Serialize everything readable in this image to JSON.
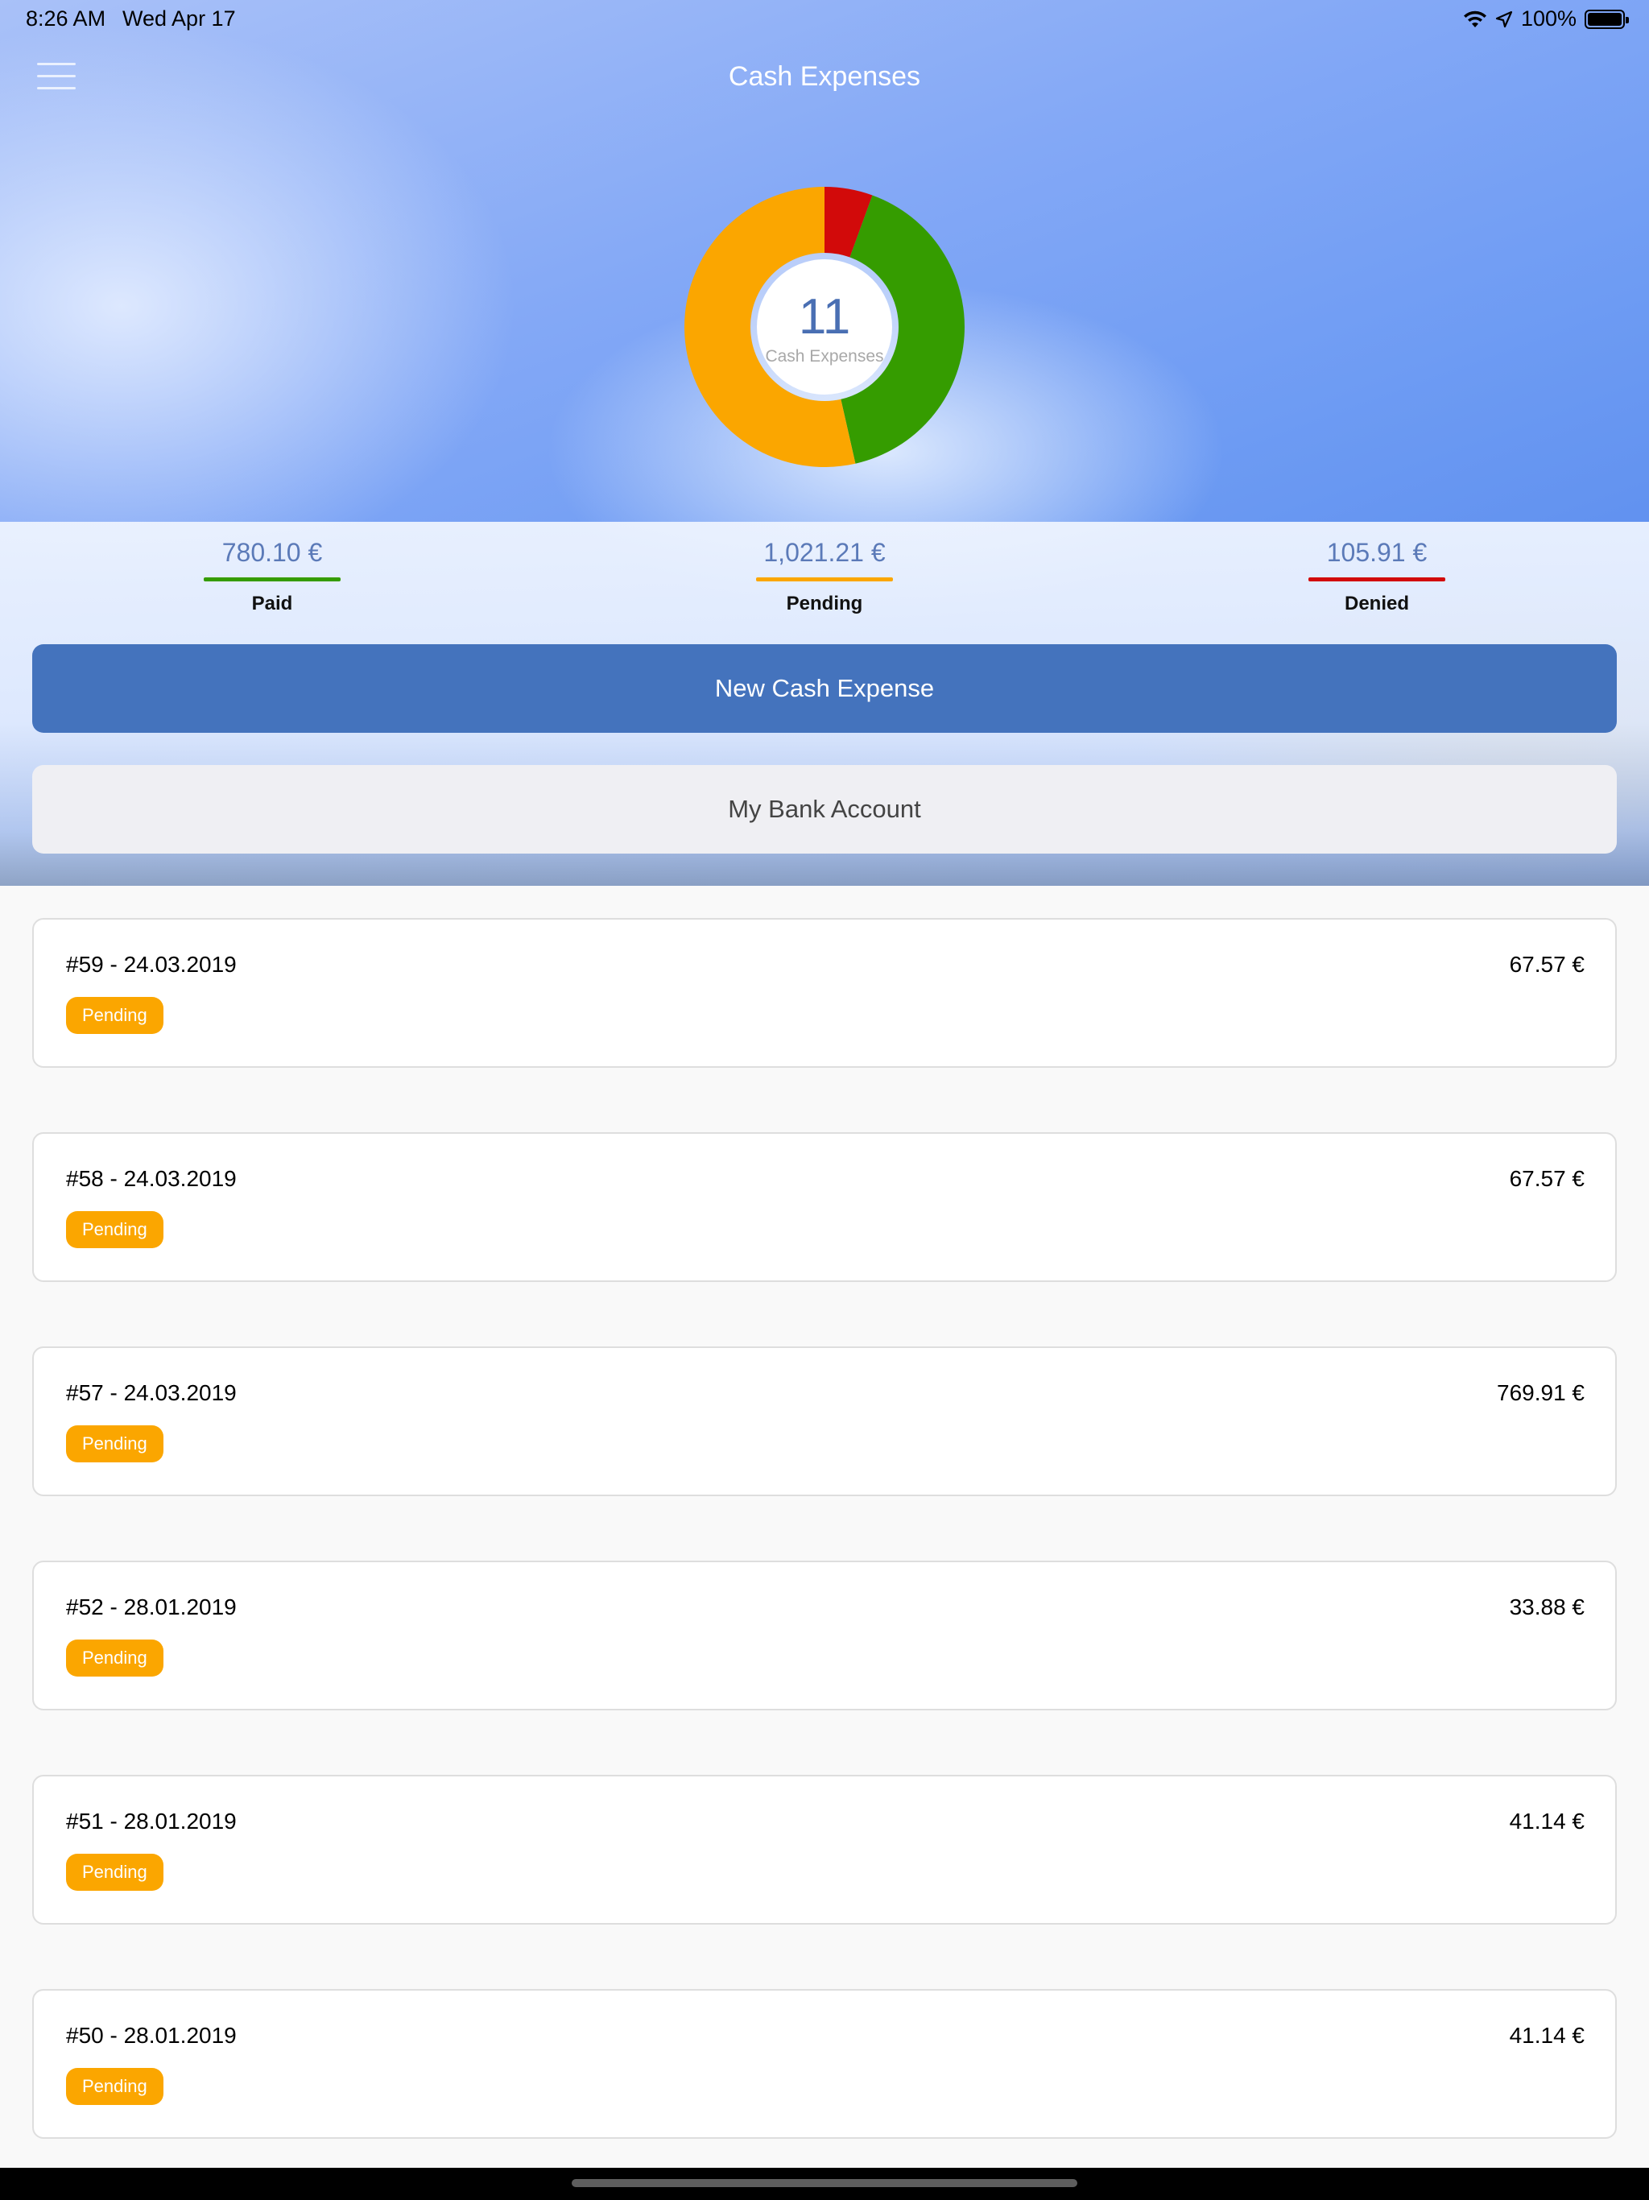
{
  "status_bar": {
    "time": "8:26 AM",
    "date": "Wed Apr 17",
    "battery": "100%",
    "icons": [
      "wifi-icon",
      "location-icon",
      "battery-icon"
    ]
  },
  "header": {
    "title": "Cash Expenses",
    "menu_icon": "hamburger-icon"
  },
  "summary": {
    "count": "11",
    "count_label": "Cash Expenses"
  },
  "chart_data": {
    "type": "pie",
    "style": "donut",
    "series": [
      {
        "name": "Paid",
        "value": 780.1,
        "color": "#359c00"
      },
      {
        "name": "Pending",
        "value": 1021.21,
        "color": "#fba600"
      },
      {
        "name": "Denied",
        "value": 105.91,
        "color": "#d20a0a"
      }
    ]
  },
  "totals": [
    {
      "amount": "780.10 €",
      "label": "Paid",
      "color": "#359c00"
    },
    {
      "amount": "1,021.21 €",
      "label": "Pending",
      "color": "#fba600"
    },
    {
      "amount": "105.91 €",
      "label": "Denied",
      "color": "#d20a0a"
    }
  ],
  "actions": {
    "new_expense": "New Cash Expense",
    "bank_account": "My Bank Account"
  },
  "expenses": [
    {
      "title": "#59 - 24.03.2019",
      "amount": "67.57 €",
      "status": "Pending"
    },
    {
      "title": "#58 - 24.03.2019",
      "amount": "67.57 €",
      "status": "Pending"
    },
    {
      "title": "#57 - 24.03.2019",
      "amount": "769.91 €",
      "status": "Pending"
    },
    {
      "title": "#52 - 28.01.2019",
      "amount": "33.88 €",
      "status": "Pending"
    },
    {
      "title": "#51 - 28.01.2019",
      "amount": "41.14 €",
      "status": "Pending"
    },
    {
      "title": "#50 - 28.01.2019",
      "amount": "41.14 €",
      "status": "Pending"
    }
  ],
  "colors": {
    "accent": "#4473bd",
    "pending": "#fba600",
    "paid": "#359c00",
    "denied": "#d20a0a"
  }
}
